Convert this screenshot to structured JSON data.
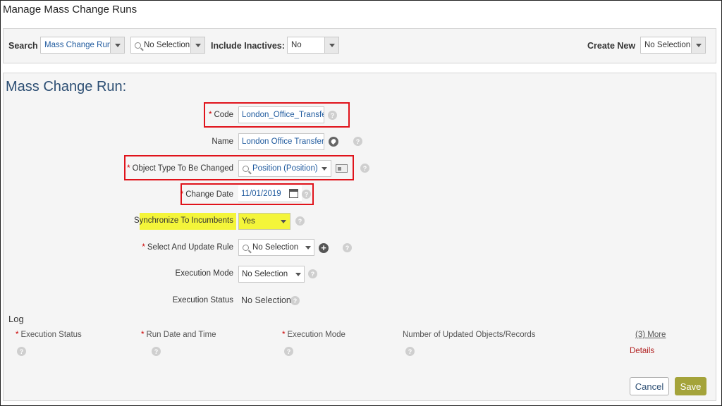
{
  "page_title": "Manage Mass Change Runs",
  "search_bar": {
    "search_label": "Search",
    "search_type_value": "Mass Change Run",
    "search_value": "No Selection",
    "include_inactives_label": "Include Inactives:",
    "include_inactives_value": "No",
    "create_new_label": "Create New",
    "create_new_value": "No Selection"
  },
  "form": {
    "title": "Mass Change Run:",
    "code_label": "Code",
    "code_value": "London_Office_Transfer",
    "name_label": "Name",
    "name_value": "London Office Transfer",
    "object_type_label": "Object Type To Be Changed",
    "object_type_value": "Position (Position)",
    "change_date_label": "Change Date",
    "change_date_value": "11/01/2019",
    "sync_label": "Synchronize To Incumbents",
    "sync_value": "Yes",
    "rule_label": "Select And Update Rule",
    "rule_value": "No Selection",
    "exec_mode_label": "Execution Mode",
    "exec_mode_value": "No Selection",
    "exec_status_label": "Execution Status",
    "exec_status_value": "No Selection",
    "required_mark": "*",
    "help_glyph": "?"
  },
  "log": {
    "title": "Log",
    "columns": [
      "Execution Status",
      "Run Date and Time",
      "Execution Mode",
      "Number of Updated Objects/Records"
    ],
    "more_link": "(3) More",
    "details_link": "Details"
  },
  "buttons": {
    "cancel": "Cancel",
    "save": "Save"
  },
  "colors": {
    "highlight_box": "#e0131b",
    "highlight_fill": "#f4f53a",
    "save_button": "#a4a33a",
    "link_red": "#b22222",
    "title_blue": "#2d4f74"
  },
  "icons": [
    "search-icon",
    "chevron-down-icon",
    "globe-icon",
    "calendar-icon",
    "card-icon",
    "add-icon",
    "help-icon"
  ]
}
